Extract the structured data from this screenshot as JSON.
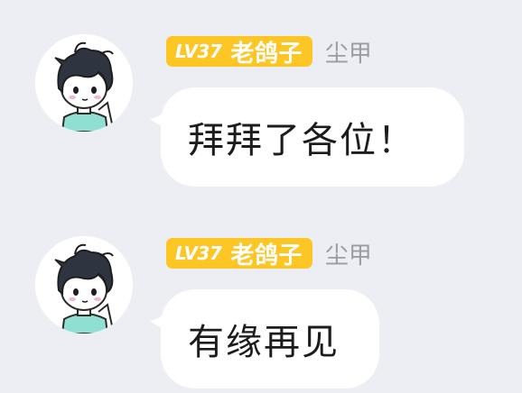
{
  "messages": [
    {
      "level": "LV37",
      "nickname": "老鸽子",
      "title": "尘甲",
      "text": "拜拜了各位！",
      "avatar_icon": "cartoon-boy-avatar"
    },
    {
      "level": "LV37",
      "nickname": "老鸽子",
      "title": "尘甲",
      "text": "有缘再见",
      "avatar_icon": "cartoon-boy-avatar"
    }
  ],
  "colors": {
    "background": "#edeef3",
    "badge": "#fcc624",
    "title_text": "#9b9ca3",
    "bubble": "#ffffff"
  }
}
